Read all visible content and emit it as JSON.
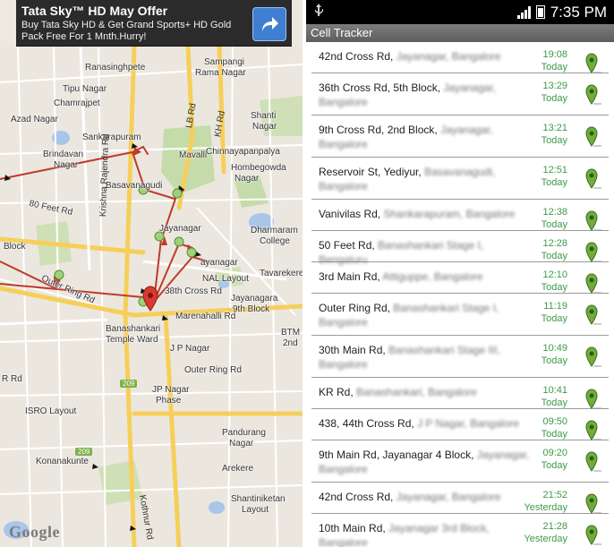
{
  "ad": {
    "title": "Tata Sky™ HD May Offer",
    "text": "Buy Tata Sky HD & Get Grand Sports+ HD Gold Pack Free For 1 Mnth.Hurry!",
    "arrow_icon": "share-arrow-icon"
  },
  "map": {
    "labels": {
      "ranasinghpete": "Ranasinghpete",
      "sampangi": "Sampangi",
      "rama_nagar": "Rama Nagar",
      "tipu_nagar": "Tipu Nagar",
      "chamrajpet": "Chamrajpet",
      "azad_nagar": "Azad Nagar",
      "shanti": "Shanti",
      "nagar": "Nagar",
      "sankarapuram": "Sankarapuram",
      "chinnayapanpalya": "Chinnayapanpalya",
      "brindavan": "Brindavan",
      "brindavan_nagar": "Nagar",
      "mavalli": "Mavalli",
      "hombegowda": "Hombegowda",
      "hombegowda_nagar": "Nagar",
      "basavanagudi": "Basavanagudi",
      "feet80": "80 Feet Rd",
      "jayanagar": "Jayanagar",
      "dharmaram": "Dharmaram",
      "college": "College",
      "block": "Block",
      "ayanagar": "ayanagar",
      "tavarekere": "Tavarekere",
      "nal_layout": "NAL Layout",
      "cross38": "38th Cross Rd",
      "jayanagara": "Jayanagara",
      "block9": "9th Block",
      "outer_ring": "Outer Ring Rd",
      "marenahalli": "Marenahalli Rd",
      "banashankari": "Banashankari",
      "temple_ward": "Temple Ward",
      "btm": "BTM",
      "btm2": "2nd",
      "jp_nagar": "J P Nagar",
      "outer_ring2": "Outer Ring Rd",
      "rr": "R Rd",
      "jp_nagar2": "JP Nagar",
      "jp_nagar2b": "Phase",
      "isro": "ISRO Layout",
      "pandurang": "Pandurang",
      "pandurang2": "Nagar",
      "konanakunte": "Konanakunte",
      "arekere": "Arekere",
      "shantiniketan": "Shantiniketan",
      "shantiniketan2": "Layout",
      "krishna": "Krishna Rajendra Rd",
      "lb_rd": "LB Rd",
      "kh_rd": "KH Rd",
      "kottanur": "Kothnur Rd",
      "badge_209a": "209",
      "badge_209b": "209",
      "google": "Google"
    }
  },
  "status_bar": {
    "usb_icon": "usb-icon",
    "time": "7:35 PM"
  },
  "app": {
    "title": "Cell Tracker"
  },
  "locations": [
    {
      "street": "42nd Cross Rd, ",
      "detail": "Jayanagar, Bangalore",
      "time": "19:08",
      "day": "Today"
    },
    {
      "street": "36th Cross Rd, 5th Block, ",
      "detail": "Jayanagar, Bangalore",
      "time": "13:29",
      "day": "Today"
    },
    {
      "street": "9th Cross Rd, 2nd Block, ",
      "detail": "Jayanagar, Bangalore",
      "time": "13:21",
      "day": "Today"
    },
    {
      "street": "Reservoir St, Yediyur, ",
      "detail": "Basavanagudi, Bangalore",
      "time": "12:51",
      "day": "Today"
    },
    {
      "street": "Vanivilas Rd, ",
      "detail": "Shankarapuram, Bangalore",
      "time": "12:38",
      "day": "Today"
    },
    {
      "street": "50 Feet Rd, ",
      "detail": "Banashankari Stage I, Bengaluru",
      "time": "12:28",
      "day": "Today"
    },
    {
      "street": "3rd Main Rd, ",
      "detail": "Attiguppe, Bangalore",
      "time": "12:10",
      "day": "Today"
    },
    {
      "street": "Outer Ring Rd, ",
      "detail": "Banashankari Stage I, Bangalore",
      "time": "11:19",
      "day": "Today"
    },
    {
      "street": "30th Main Rd, ",
      "detail": "Banashankari Stage III, Bangalore",
      "time": "10:49",
      "day": "Today"
    },
    {
      "street": "KR Rd, ",
      "detail": "Banashankari, Bangalore",
      "time": "10:41",
      "day": "Today"
    },
    {
      "street": "438, 44th Cross Rd, ",
      "detail": "J P Nagar, Bangalore",
      "time": "09:50",
      "day": "Today"
    },
    {
      "street": "9th Main Rd, Jayanagar 4 Block, ",
      "detail": "Jayanagar, Bangalore",
      "time": "09:20",
      "day": "Today"
    },
    {
      "street": "42nd Cross Rd, ",
      "detail": "Jayanagar, Bangalore",
      "time": "21:52",
      "day": "Yesterday"
    },
    {
      "street": "10th Main Rd, ",
      "detail": "Jayanagar 3rd Block, Bangalore",
      "time": "21:28",
      "day": "Yesterday"
    }
  ],
  "colors": {
    "accent_green": "#3c9a4a",
    "route_red": "#c0392b",
    "pin_red": "#d93a30",
    "pin_green": "#6fae3a"
  }
}
